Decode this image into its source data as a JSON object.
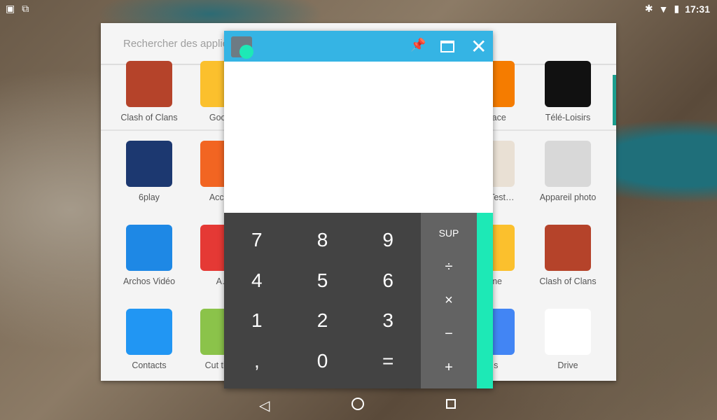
{
  "status_bar": {
    "time": "17:31",
    "icons": [
      "gallery-icon",
      "screenshot-icon",
      "bluetooth-icon",
      "wifi-icon",
      "battery-icon"
    ]
  },
  "drawer": {
    "search_placeholder": "Rechercher des applications",
    "apps": [
      {
        "label": "Clash of Clans",
        "color": "#b5432a"
      },
      {
        "label": "Google",
        "color": "#fbc02d"
      },
      {
        "label": "Espace",
        "color": "#f57c00"
      },
      {
        "label": "Télé-Loisirs",
        "color": "#111111"
      },
      {
        "label": "6play",
        "color": "#1c3870"
      },
      {
        "label": "Accu…",
        "color": "#f26522"
      },
      {
        "label": "…eo Test…",
        "color": "#e9e0d4"
      },
      {
        "label": "Appareil photo",
        "color": "#d8d8d8"
      },
      {
        "label": "Archos Vidéo",
        "color": "#1e88e5"
      },
      {
        "label": "A…",
        "color": "#e53935"
      },
      {
        "label": "…me",
        "color": "#fbc02d"
      },
      {
        "label": "Clash of Clans",
        "color": "#b5432a"
      },
      {
        "label": "Contacts",
        "color": "#2196f3"
      },
      {
        "label": "Cut the…",
        "color": "#8bc34a"
      },
      {
        "label": "…s",
        "color": "#4285f4"
      },
      {
        "label": "Drive",
        "color": "#ffffff"
      }
    ]
  },
  "calculator": {
    "title_colors": {
      "bar": "#35b4e4",
      "accent": "#1de9b6"
    },
    "display_value": "",
    "digits": [
      "7",
      "8",
      "9",
      "4",
      "5",
      "6",
      "1",
      "2",
      "3",
      ",",
      "0",
      "="
    ],
    "ops": [
      "SUP",
      "÷",
      "×",
      "−",
      "+"
    ]
  },
  "nav": {
    "back": "back-icon",
    "home": "home-icon",
    "recents": "recents-icon"
  }
}
